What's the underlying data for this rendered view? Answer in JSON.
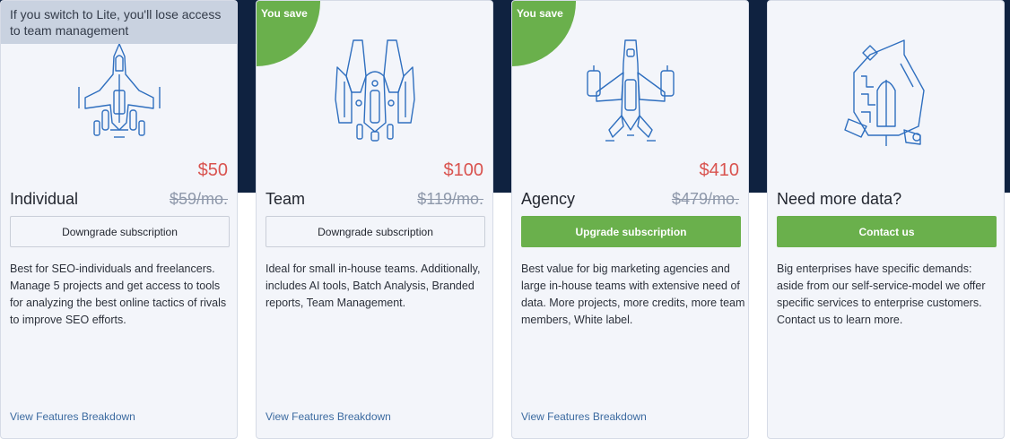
{
  "notice": "If you switch to Lite, you'll lose access to team management",
  "ribbon_label": "You save",
  "cards": [
    {
      "name": "Individual",
      "price": "$50",
      "old_price": "$59/mo.",
      "button": "Downgrade subscription",
      "description": "Best for SEO-individuals and freelancers. Manage 5 projects and get access to tools for analyzing the best online tactics of rivals to improve SEO efforts.",
      "link": "View Features Breakdown"
    },
    {
      "name": "Team",
      "price": "$100",
      "old_price": "$119/mo.",
      "button": "Downgrade subscription",
      "description": "Ideal for small in-house teams. Additionally, includes AI tools, Batch Analysis, Branded reports, Team Management.",
      "link": "View Features Breakdown"
    },
    {
      "name": "Agency",
      "price": "$410",
      "old_price": "$479/mo.",
      "button": "Upgrade subscription",
      "description": "Best value for big marketing agencies and large in-house teams with extensive need of data. More projects, more credits, more team members, White label.",
      "link": "View Features Breakdown"
    },
    {
      "name": "Need more data?",
      "button": "Contact us",
      "description": "Big enterprises have specific demands: aside from our self-service-model we offer specific services to enterprise customers. Contact us to learn more."
    }
  ],
  "icons": [
    "fighter-jet-icon",
    "clawed-ship-icon",
    "winged-cruiser-icon",
    "mothership-icon"
  ],
  "colors": {
    "background_band": "#0f2240",
    "card_background": "#f3f5fa",
    "accent_green": "#6ab04c",
    "price_red": "#d9534f",
    "strikethrough_gray": "#8e98aa",
    "link_blue": "#3b6aa0",
    "icon_blue": "#2f6fbf",
    "notice_background": "#c9d2e0"
  }
}
